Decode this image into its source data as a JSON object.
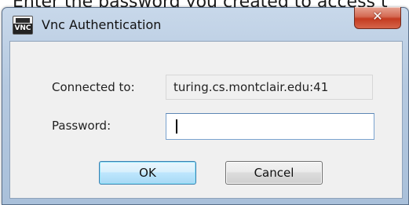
{
  "background": {
    "instruction_text": "Enter the password you created to access t"
  },
  "window": {
    "title": "Vnc Authentication",
    "app_icon_text": "VNC",
    "close_glyph": "✕",
    "close_color": "#c43b20"
  },
  "form": {
    "connected_label": "Connected to:",
    "connected_value": "turing.cs.montclair.edu:41",
    "password_label": "Password:",
    "password_value": ""
  },
  "buttons": {
    "ok_label": "OK",
    "cancel_label": "Cancel"
  },
  "colors": {
    "titlebar": "#b5c9e0",
    "client": "#f0f0f0",
    "ok_border": "#3c7fb1"
  }
}
